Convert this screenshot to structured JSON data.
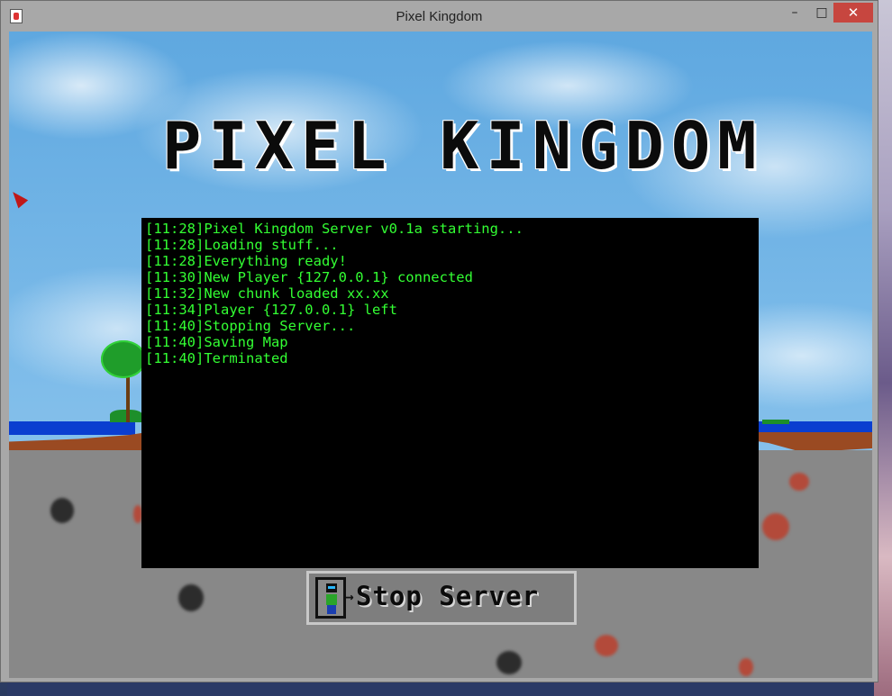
{
  "window": {
    "title": "Pixel Kingdom",
    "minimize_icon": "minimize-icon",
    "maximize_icon": "maximize-icon",
    "close_icon": "close-icon"
  },
  "game": {
    "title": "PIXEL KINGDOM",
    "console_lines": [
      "[11:28]Pixel Kingdom Server v0.1a starting...",
      "[11:28]Loading stuff...",
      "[11:28]Everything ready!",
      "[11:30]New Player {127.0.0.1} connected",
      "[11:32]New chunk loaded xx.xx",
      "[11:34]Player {127.0.0.1} left",
      "[11:40]Stopping Server...",
      "[11:40]Saving Map",
      "[11:40]Terminated"
    ],
    "stop_button": {
      "label": "Stop Server",
      "icon": "player-exit-icon"
    }
  },
  "colors": {
    "console_text": "#33ff33",
    "console_background": "#000000",
    "sky": "#7cbbe9",
    "water": "#0a3ed0",
    "dirt": "#9a4a22",
    "stone": "#888888",
    "close_button": "#c7463f"
  }
}
